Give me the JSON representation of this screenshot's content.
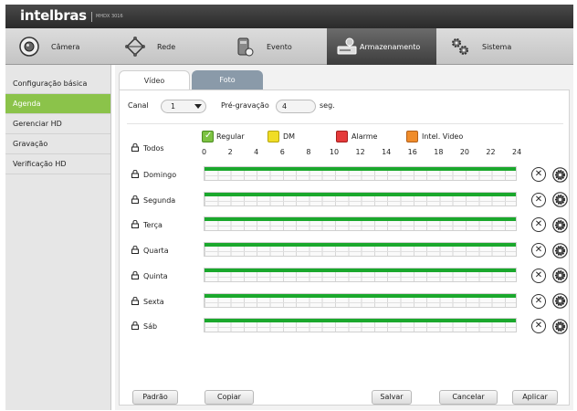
{
  "header": {
    "brand": "intelbras",
    "model": "MHDX 3016"
  },
  "nav": {
    "items": [
      {
        "label": "Câmera",
        "icon": "camera-icon"
      },
      {
        "label": "Rede",
        "icon": "network-icon"
      },
      {
        "label": "Evento",
        "icon": "event-icon"
      },
      {
        "label": "Armazenamento",
        "icon": "storage-icon",
        "active": true
      },
      {
        "label": "Sistema",
        "icon": "system-gears-icon"
      }
    ]
  },
  "sidebar": {
    "items": [
      {
        "label": "Configuração básica"
      },
      {
        "label": "Agenda",
        "active": true
      },
      {
        "label": "Gerenciar HD"
      },
      {
        "label": "Gravação"
      },
      {
        "label": "Verificação HD"
      }
    ]
  },
  "tabs": [
    {
      "label": "Vídeo",
      "active": true
    },
    {
      "label": "Foto"
    }
  ],
  "form": {
    "canal_label": "Canal",
    "canal_value": "1",
    "pregravacao_label": "Pré-gravação",
    "pregravacao_value": "4",
    "seg_label": "seg."
  },
  "legend": [
    {
      "label": "Regular",
      "color": "#7cc242",
      "checked": true
    },
    {
      "label": "DM",
      "color": "#f0dd26"
    },
    {
      "label": "Alarme",
      "color": "#e53a3a"
    },
    {
      "label": "Intel. Video",
      "color": "#f08c2a"
    }
  ],
  "schedule": {
    "todos_label": "Todos",
    "hours": [
      "0",
      "2",
      "4",
      "6",
      "8",
      "10",
      "12",
      "14",
      "16",
      "18",
      "20",
      "22",
      "24"
    ],
    "bar_color": "#1aa82c",
    "days": [
      {
        "label": "Domingo",
        "start": 0,
        "end": 24
      },
      {
        "label": "Segunda",
        "start": 0,
        "end": 24
      },
      {
        "label": "Terça",
        "start": 0,
        "end": 24
      },
      {
        "label": "Quarta",
        "start": 0,
        "end": 24
      },
      {
        "label": "Quinta",
        "start": 0,
        "end": 24
      },
      {
        "label": "Sexta",
        "start": 0,
        "end": 24
      },
      {
        "label": "Sáb",
        "start": 0,
        "end": 24
      }
    ]
  },
  "buttons": {
    "padrao": "Padrão",
    "copiar": "Copiar",
    "salvar": "Salvar",
    "cancelar": "Cancelar",
    "aplicar": "Aplicar"
  }
}
